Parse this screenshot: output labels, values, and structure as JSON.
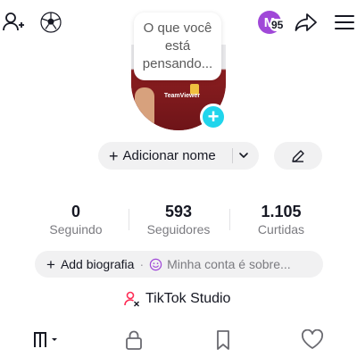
{
  "header": {
    "notification_initial": "M",
    "notification_count": "95",
    "icons": [
      "add-user-icon",
      "soccer-ball-icon",
      "share-icon",
      "menu-icon"
    ]
  },
  "profile": {
    "thought_bubble": "O que você está pensando...",
    "add_name_label": "Adicionar nome",
    "avatar_shirt_text": "TeamViewer"
  },
  "stats": [
    {
      "value": "0",
      "label": "Seguindo"
    },
    {
      "value": "593",
      "label": "Seguidores"
    },
    {
      "value": "1.105",
      "label": "Curtidas"
    }
  ],
  "bio": {
    "add_label": "Add biografia",
    "separator": "·",
    "placeholder": "Minha conta é sobre..."
  },
  "studio": {
    "label": "TikTok Studio"
  },
  "tabs": [
    "grid-icon",
    "lock-icon",
    "bookmark-icon",
    "heart-icon"
  ],
  "colors": {
    "accent_cyan": "#20d5ec",
    "notification_purple": "#a048d8",
    "studio_pink": "#fe2c55",
    "pill_bg": "#f1f1f2"
  }
}
